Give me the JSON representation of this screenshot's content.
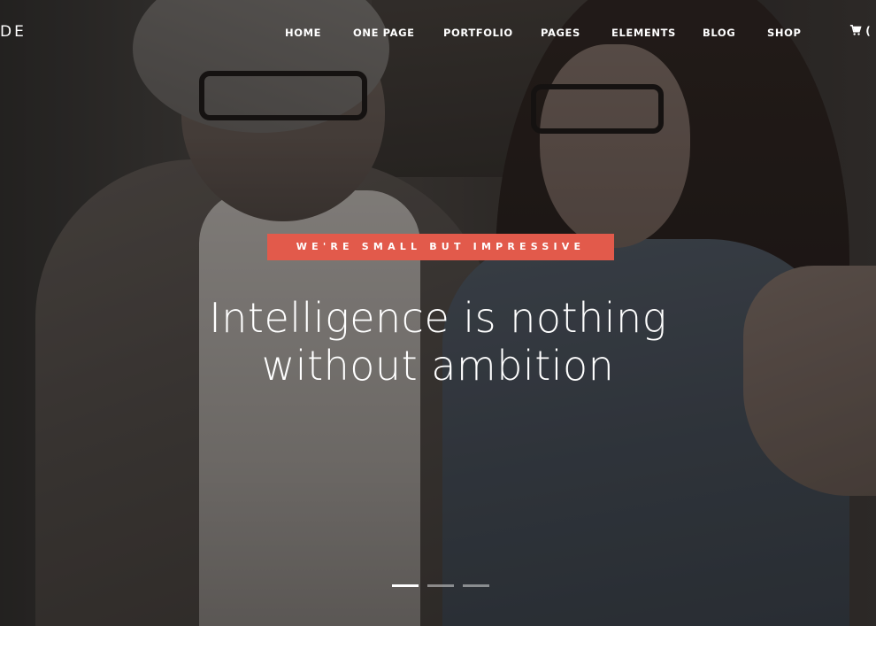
{
  "header": {
    "logo_text": "DE",
    "nav": [
      "HOME",
      "ONE PAGE",
      "PORTFOLIO",
      "PAGES",
      "ELEMENTS",
      "BLOG",
      "SHOP"
    ],
    "cart_count_text": "(",
    "cart_icon": "shopping-cart-icon"
  },
  "hero": {
    "tagline": "WE'RE SMALL BUT IMPRESSIVE",
    "headline_line1": "Intelligence is nothing",
    "headline_line2": "without ambition",
    "slider": {
      "slides": 3,
      "active_index": 0
    }
  },
  "colors": {
    "accent": "#e25a4b",
    "text": "#ffffff"
  }
}
